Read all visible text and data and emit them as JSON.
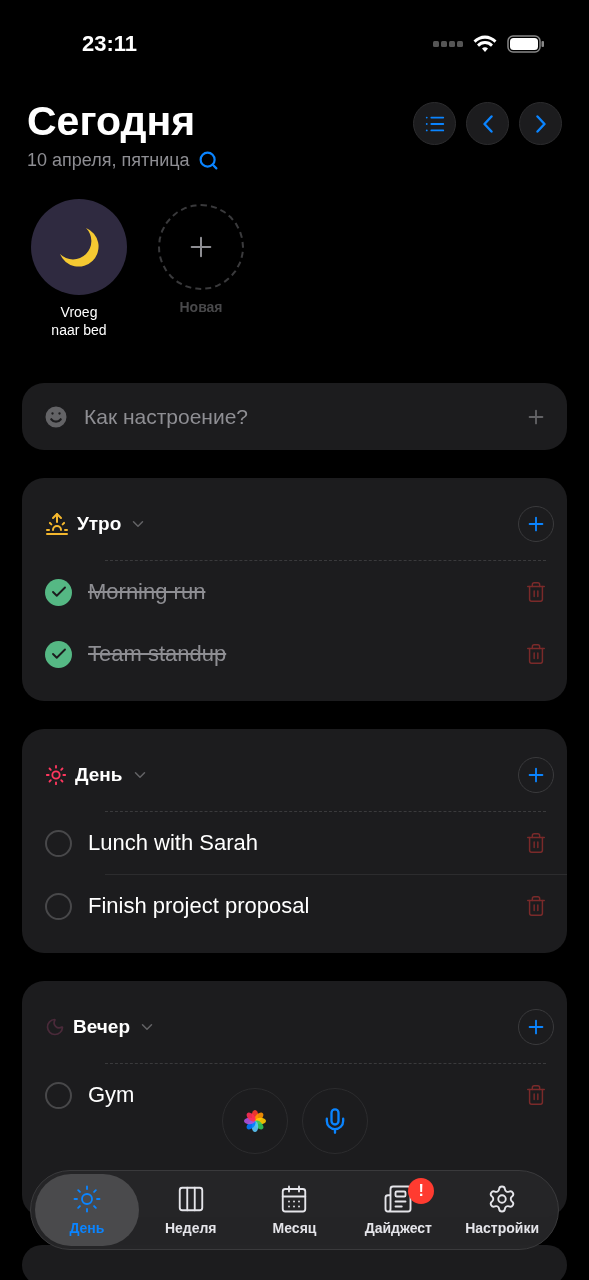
{
  "status_bar": {
    "time": "23:11"
  },
  "header": {
    "title": "Сегодня",
    "date": "10 апреля, пятница"
  },
  "routines": [
    {
      "kind": "routine",
      "label": "Vroeg\nnaar bed"
    },
    {
      "kind": "new",
      "label": "Новая"
    }
  ],
  "mood": {
    "placeholder": "Как настроение?"
  },
  "sections": [
    {
      "kind": "morning",
      "title": "Утро",
      "tasks": [
        {
          "text": "Morning run",
          "checked": true
        },
        {
          "text": "Team standup",
          "checked": true
        }
      ]
    },
    {
      "kind": "day",
      "title": "День",
      "tasks": [
        {
          "text": "Lunch with Sarah",
          "checked": false
        },
        {
          "text": "Finish project proposal",
          "checked": false
        }
      ]
    },
    {
      "kind": "evening",
      "title": "Вечер",
      "tasks": [
        {
          "text": "Gym",
          "checked": false
        }
      ]
    }
  ],
  "tab_bar": [
    {
      "kind": "day",
      "label": "День",
      "selected": true,
      "badge": false
    },
    {
      "kind": "week",
      "label": "Неделя",
      "selected": false,
      "badge": false
    },
    {
      "kind": "month",
      "label": "Месяц",
      "selected": false,
      "badge": false
    },
    {
      "kind": "digest",
      "label": "Дайджест",
      "selected": false,
      "badge": true,
      "badge_text": "!"
    },
    {
      "kind": "settings",
      "label": "Настройки",
      "selected": false,
      "badge": false
    }
  ]
}
